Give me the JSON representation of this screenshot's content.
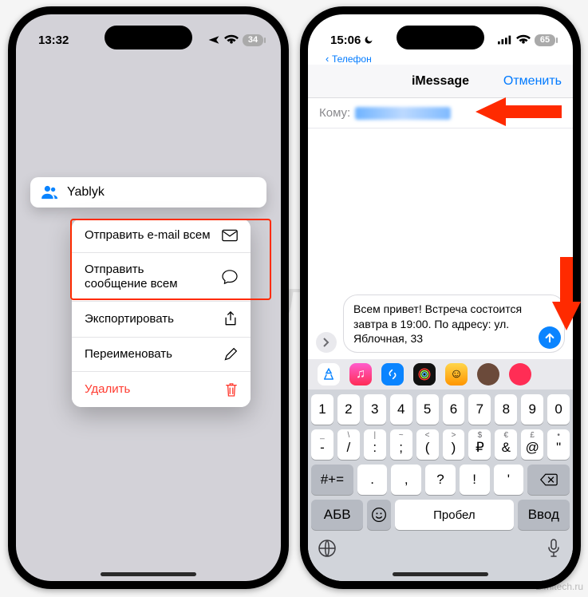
{
  "watermark": "Яблык",
  "site_mark": "24hitech.ru",
  "left": {
    "status": {
      "time": "13:32",
      "battery": "34"
    },
    "contacts_chip": "Yablyk",
    "menu": {
      "email_all": "Отправить e-mail всем",
      "message_all": "Отправить\nсообщение всем",
      "export": "Экспортировать",
      "rename": "Переименовать",
      "delete": "Удалить"
    }
  },
  "right": {
    "status": {
      "time": "15:06",
      "battery": "65",
      "back": "Телефон"
    },
    "nav": {
      "title": "iMessage",
      "cancel": "Отменить"
    },
    "to_label": "Кому:",
    "compose_text": "Всем привет! Встреча состоится завтра в 19:00. По адресу: ул. Яблочная, 33",
    "keyboard": {
      "row1": [
        "1",
        "2",
        "3",
        "4",
        "5",
        "6",
        "7",
        "8",
        "9",
        "0"
      ],
      "row2": [
        "-",
        "/",
        ":",
        ";",
        "(",
        ")",
        "₽",
        "&",
        "@",
        "\""
      ],
      "row2_shift": [
        "_",
        "\\",
        "|",
        "~",
        "<",
        ">",
        "$",
        "€",
        "£",
        "•"
      ],
      "row3_left": "#+=",
      "row3": [
        ".",
        ",",
        "?",
        "!",
        "'"
      ],
      "row4": {
        "abc": "АБВ",
        "space": "Пробел",
        "enter": "Ввод"
      }
    }
  }
}
